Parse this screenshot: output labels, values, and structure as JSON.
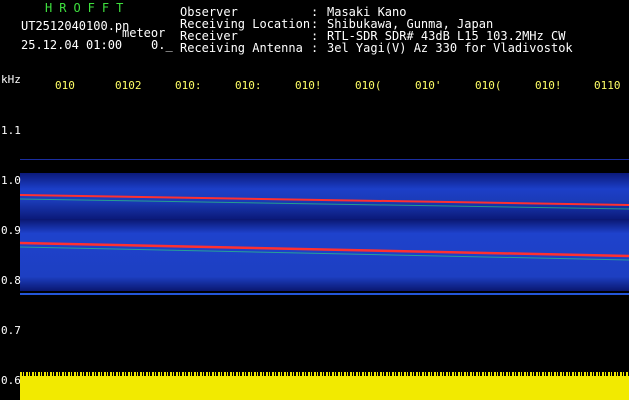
{
  "header": {
    "title": "HROFFT",
    "filename": "UT2512040100.pn",
    "file_suffix": "meteor",
    "datetime": "25.12.04 01:00    0._"
  },
  "info": [
    {
      "label": "Observer",
      "value": "Masaki Kano"
    },
    {
      "label": "Receiving Location",
      "value": "Shibukawa, Gunma, Japan"
    },
    {
      "label": "Receiver",
      "value": "RTL-SDR SDR# 43dB L15 103.2MHz CW"
    },
    {
      "label": "Receiving Antenna",
      "value": "3el Yagi(V) Az 330 for Vladivostok"
    }
  ],
  "axis": {
    "unit": "kHz",
    "y_labels": [
      "1.1",
      "1.0",
      "0.9",
      "0.8",
      "0.7",
      "0.6"
    ],
    "x_labels": [
      "010",
      "0102",
      "010:",
      "010:",
      "010!",
      "010(",
      "010'",
      "010(",
      "010!",
      "0110"
    ]
  },
  "colors": {
    "background": "#000000",
    "title": "#3ee03e",
    "tick": "#ffff66",
    "noise_floor": "#f2ea00",
    "trace": "#ff3030"
  }
}
